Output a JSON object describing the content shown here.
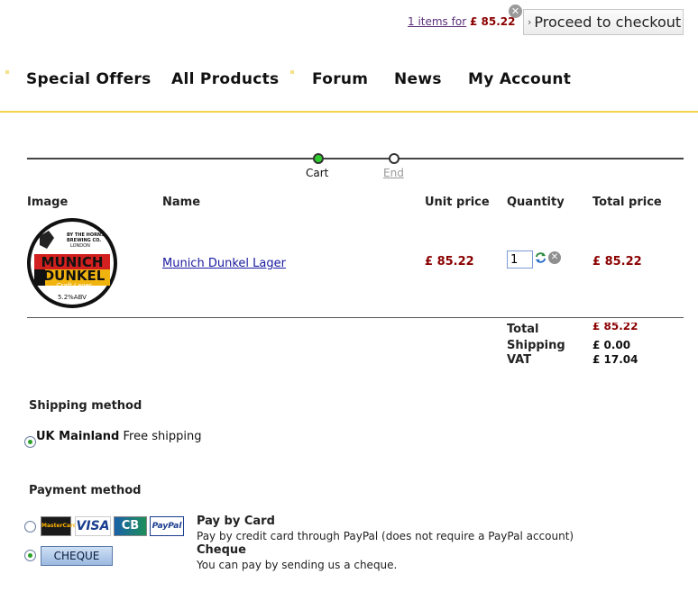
{
  "cart_summary": {
    "items_text": "1 items for",
    "amount": "£ 85.22",
    "checkout_label": "Proceed to checkout",
    "checkout_arrow": "›",
    "close_symbol": "✕"
  },
  "nav": {
    "items": [
      "Special Offers",
      "All Products",
      "Forum",
      "News",
      "My Account"
    ]
  },
  "progress": {
    "steps": [
      {
        "label": "Cart",
        "state": "current"
      },
      {
        "label": "End",
        "state": "pending"
      }
    ]
  },
  "table": {
    "headers": [
      "Image",
      "Name",
      "Unit price",
      "Quantity",
      "Total price"
    ],
    "rows": [
      {
        "product_name": "Munich Dunkel Lager",
        "unit_price": "£ 85.22",
        "quantity": "1",
        "total_price": "£ 85.22",
        "image": {
          "brand_line1": "BY THE HORNS",
          "brand_line2": "BREWING CO.",
          "brand_line3": "LONDON",
          "title1": "MUNICH",
          "title2": "DUNKEL",
          "subtitle": "Craft Lager",
          "abv": "5.2%ABV"
        }
      }
    ],
    "remove_symbol": "✕"
  },
  "totals": {
    "total_label": "Total",
    "total_value": "£ 85.22",
    "shipping_label": "Shipping",
    "shipping_value": "£ 0.00",
    "vat_label": "VAT",
    "vat_value": "£ 17.04"
  },
  "shipping": {
    "title": "Shipping method",
    "option_name": "UK Mainland",
    "option_desc": "Free shipping"
  },
  "payment": {
    "title": "Payment method",
    "logos": [
      "MasterCard",
      "VISA",
      "CB",
      "PayPal"
    ],
    "card_title": "Pay by Card",
    "card_desc": "Pay by credit card through PayPal (does not require a PayPal account)",
    "cheque_button": "CHEQUE",
    "cheque_title": "Cheque",
    "cheque_desc": "You can pay by sending us a cheque."
  },
  "colors": {
    "price": "#8b0000",
    "nav_underline": "#f3d34a",
    "active_step": "#2ecc2e"
  }
}
